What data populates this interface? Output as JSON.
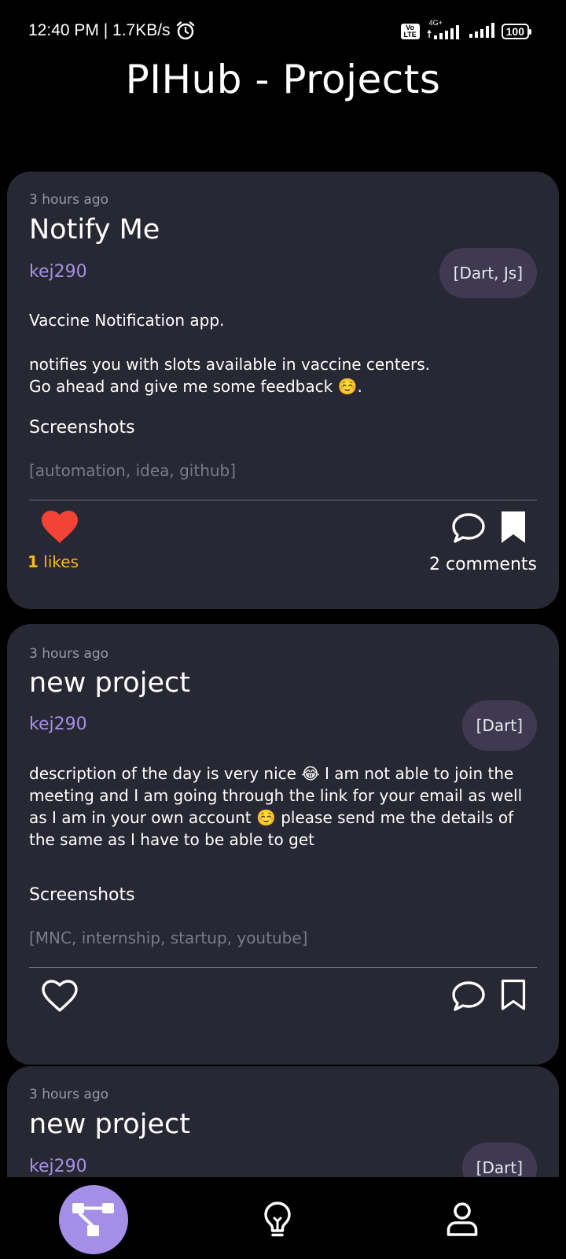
{
  "status_bar": {
    "time": "12:40 PM | 1.7KB/s",
    "alarm_icon": "alarm-clock-icon",
    "volte": "Vo LTE",
    "network": "4G+",
    "battery": "100"
  },
  "header": {
    "title": "PIHub - Projects"
  },
  "posts": [
    {
      "time": "3 hours ago",
      "title": "Notify Me",
      "author": "kej290",
      "languages": "[Dart, Js]",
      "description": "Vaccine Notification app.\n\nnotifies you with slots available in vaccine centers.\nGo ahead and give me some feedback ☺️.",
      "screenshots_label": "Screenshots",
      "tags": "[automation, idea, github]",
      "liked": true,
      "like_count": "1",
      "likes_suffix": " likes",
      "comments": "2 comments"
    },
    {
      "time": "3 hours ago",
      "title": "new project",
      "author": "kej290",
      "languages": "[Dart]",
      "description": "description of the day is very nice 😂 I am not able to join the meeting and I am going through the link for your email as well as I am in your own account ☺️ please send me the details of the same as I have to be able to get",
      "screenshots_label": "Screenshots",
      "tags": "[MNC, internship, startup, youtube]",
      "liked": false
    },
    {
      "time": "3 hours ago",
      "title": "new project",
      "author": "kej290",
      "languages": "[Dart]"
    }
  ],
  "bottom_nav": {
    "items": [
      {
        "icon": "projects-tree-icon",
        "active": true
      },
      {
        "icon": "lightbulb-icon",
        "active": false
      },
      {
        "icon": "profile-icon",
        "active": false
      }
    ]
  },
  "colors": {
    "background": "#000000",
    "card": "#282834",
    "accent": "#a58fe6",
    "like_red": "#f44336",
    "likes_yellow": "#f6b81e",
    "pill": "#3f3a52"
  }
}
